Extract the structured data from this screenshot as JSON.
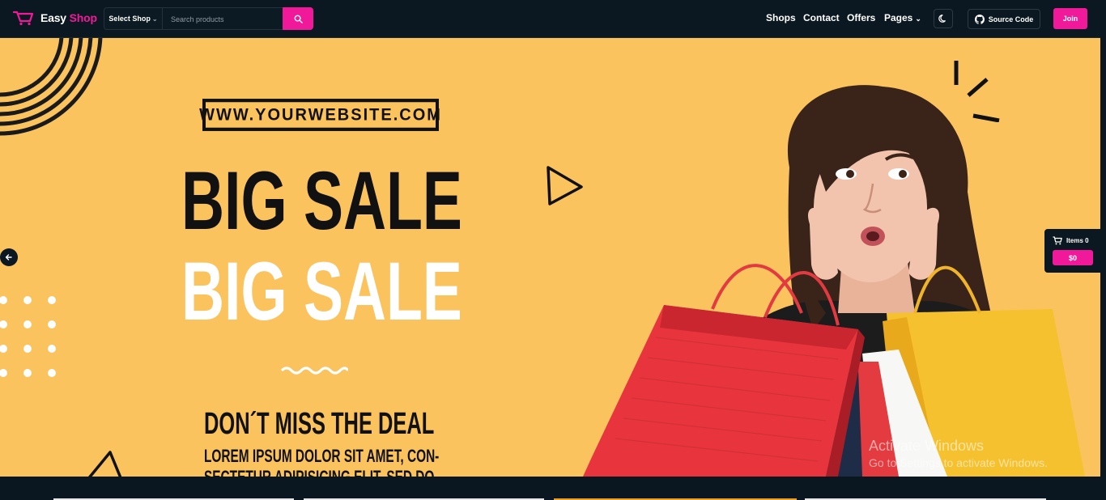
{
  "header": {
    "logo_text_1": "Easy",
    "logo_text_2": "Shop",
    "shop_select_label": "Select Shop",
    "search_placeholder": "Search products",
    "nav": [
      "Shops",
      "Contact",
      "Offers",
      "Pages"
    ],
    "source_code_label": "Source Code",
    "join_label": "Join"
  },
  "banner": {
    "url_text": "WWW.YOURWEBSITE.COM",
    "headline_1": "BIG SALE",
    "headline_2": "BIG SALE",
    "tagline": "DON´T MISS THE DEAL",
    "body_line_1": "LOREM IPSUM DOLOR SIT AMET, CON-",
    "body_line_2": "SECTETUR ADIPISICING ELIT, SED DO"
  },
  "cart": {
    "items_label": "Items 0",
    "total": "$0"
  },
  "watermark": {
    "title": "Activate Windows",
    "subtitle": "Go to Settings to activate Windows."
  },
  "colors": {
    "accent": "#f0199a",
    "header_bg": "#0b1821",
    "banner_bg": "#fbc35e"
  }
}
